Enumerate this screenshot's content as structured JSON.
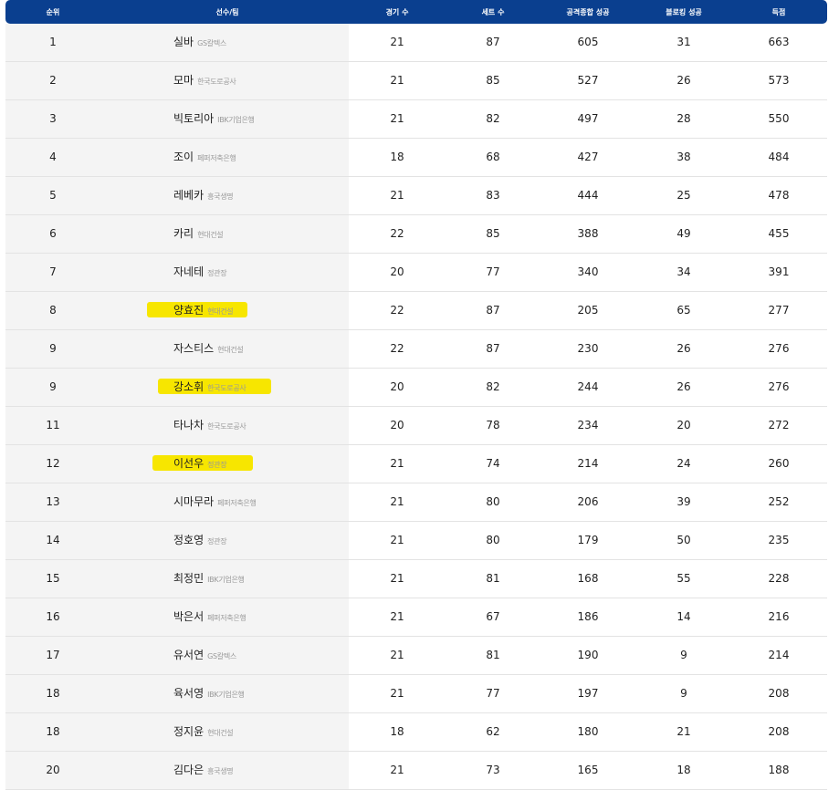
{
  "header": {
    "rank": "순위",
    "player_team": "선수/팀",
    "games": "경기 수",
    "sets": "세트 수",
    "attack_success": "공격종합 성공",
    "block_success": "블로킹 성공",
    "points": "득점"
  },
  "highlight_color": "#f7e600",
  "rows": [
    {
      "rank": "1",
      "name": "실바",
      "team": "GS칼텍스",
      "games": "21",
      "sets": "87",
      "attack": "605",
      "block": "31",
      "points": "663",
      "highlight": false
    },
    {
      "rank": "2",
      "name": "모마",
      "team": "한국도로공사",
      "games": "21",
      "sets": "85",
      "attack": "527",
      "block": "26",
      "points": "573",
      "highlight": false
    },
    {
      "rank": "3",
      "name": "빅토리아",
      "team": "IBK기업은행",
      "games": "21",
      "sets": "82",
      "attack": "497",
      "block": "28",
      "points": "550",
      "highlight": false
    },
    {
      "rank": "4",
      "name": "조이",
      "team": "페퍼저축은행",
      "games": "18",
      "sets": "68",
      "attack": "427",
      "block": "38",
      "points": "484",
      "highlight": false
    },
    {
      "rank": "5",
      "name": "레베카",
      "team": "흥국생명",
      "games": "21",
      "sets": "83",
      "attack": "444",
      "block": "25",
      "points": "478",
      "highlight": false
    },
    {
      "rank": "6",
      "name": "카리",
      "team": "현대건설",
      "games": "22",
      "sets": "85",
      "attack": "388",
      "block": "49",
      "points": "455",
      "highlight": false
    },
    {
      "rank": "7",
      "name": "자네테",
      "team": "정관장",
      "games": "20",
      "sets": "77",
      "attack": "340",
      "block": "34",
      "points": "391",
      "highlight": false
    },
    {
      "rank": "8",
      "name": "양효진",
      "team": "현대건설",
      "games": "22",
      "sets": "87",
      "attack": "205",
      "block": "65",
      "points": "277",
      "highlight": true
    },
    {
      "rank": "9",
      "name": "자스티스",
      "team": "현대건설",
      "games": "22",
      "sets": "87",
      "attack": "230",
      "block": "26",
      "points": "276",
      "highlight": false
    },
    {
      "rank": "9",
      "name": "강소휘",
      "team": "한국도로공사",
      "games": "20",
      "sets": "82",
      "attack": "244",
      "block": "26",
      "points": "276",
      "highlight": true
    },
    {
      "rank": "11",
      "name": "타나차",
      "team": "한국도로공사",
      "games": "20",
      "sets": "78",
      "attack": "234",
      "block": "20",
      "points": "272",
      "highlight": false
    },
    {
      "rank": "12",
      "name": "이선우",
      "team": "정관장",
      "games": "21",
      "sets": "74",
      "attack": "214",
      "block": "24",
      "points": "260",
      "highlight": true
    },
    {
      "rank": "13",
      "name": "시마무라",
      "team": "페퍼저축은행",
      "games": "21",
      "sets": "80",
      "attack": "206",
      "block": "39",
      "points": "252",
      "highlight": false
    },
    {
      "rank": "14",
      "name": "정호영",
      "team": "정관장",
      "games": "21",
      "sets": "80",
      "attack": "179",
      "block": "50",
      "points": "235",
      "highlight": false
    },
    {
      "rank": "15",
      "name": "최정민",
      "team": "IBK기업은행",
      "games": "21",
      "sets": "81",
      "attack": "168",
      "block": "55",
      "points": "228",
      "highlight": false
    },
    {
      "rank": "16",
      "name": "박은서",
      "team": "페퍼저축은행",
      "games": "21",
      "sets": "67",
      "attack": "186",
      "block": "14",
      "points": "216",
      "highlight": false
    },
    {
      "rank": "17",
      "name": "유서연",
      "team": "GS칼텍스",
      "games": "21",
      "sets": "81",
      "attack": "190",
      "block": "9",
      "points": "214",
      "highlight": false
    },
    {
      "rank": "18",
      "name": "육서영",
      "team": "IBK기업은행",
      "games": "21",
      "sets": "77",
      "attack": "197",
      "block": "9",
      "points": "208",
      "highlight": false
    },
    {
      "rank": "18",
      "name": "정지윤",
      "team": "현대건설",
      "games": "18",
      "sets": "62",
      "attack": "180",
      "block": "21",
      "points": "208",
      "highlight": false
    },
    {
      "rank": "20",
      "name": "김다은",
      "team": "흥국생명",
      "games": "21",
      "sets": "73",
      "attack": "165",
      "block": "18",
      "points": "188",
      "highlight": false
    }
  ]
}
